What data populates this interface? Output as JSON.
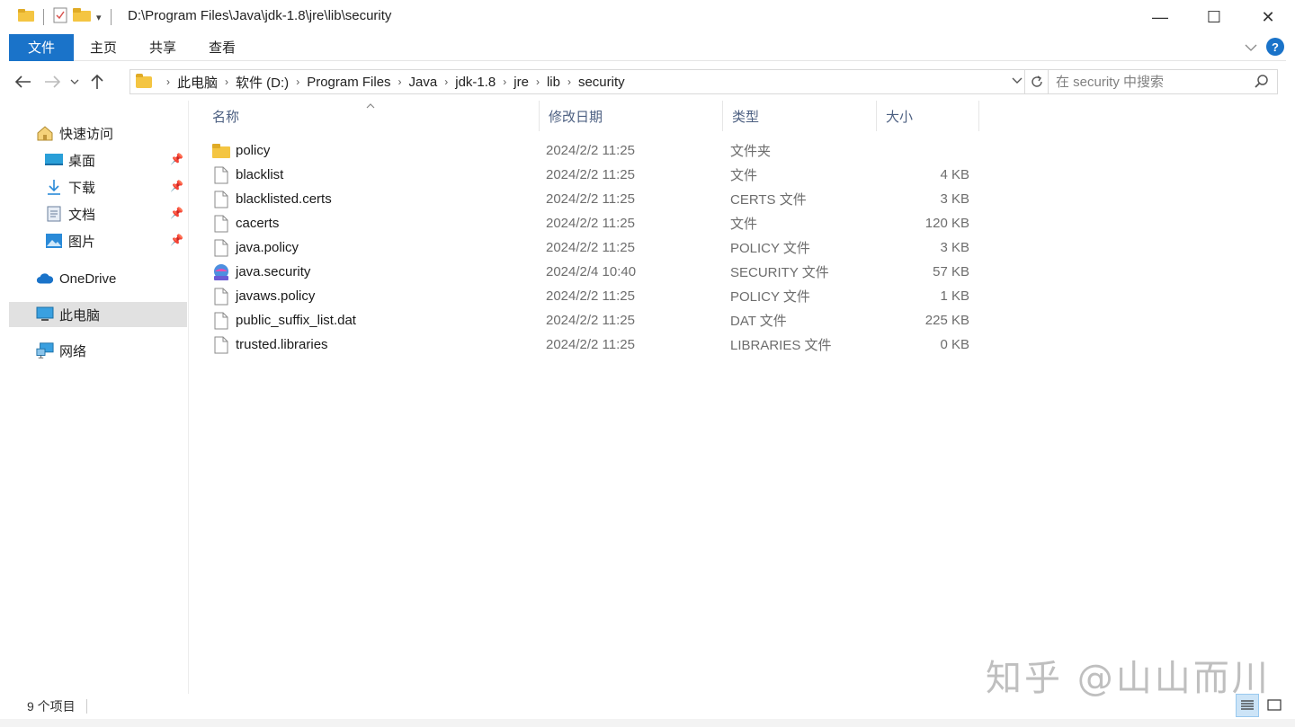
{
  "window": {
    "title": "D:\\Program Files\\Java\\jdk-1.8\\jre\\lib\\security",
    "minimize": "—",
    "maximize": "☐",
    "close": "✕"
  },
  "ribbon": {
    "tabs": [
      "文件",
      "主页",
      "共享",
      "查看"
    ],
    "help": "?"
  },
  "address": {
    "crumbs": [
      "此电脑",
      "软件 (D:)",
      "Program Files",
      "Java",
      "jdk-1.8",
      "jre",
      "lib",
      "security"
    ]
  },
  "search": {
    "placeholder": "在 security 中搜索"
  },
  "sidebar": {
    "items": [
      {
        "label": "快速访问",
        "icon": "star-icon"
      },
      {
        "label": "桌面",
        "icon": "desktop-icon",
        "pinned": true
      },
      {
        "label": "下载",
        "icon": "download-icon",
        "pinned": true
      },
      {
        "label": "文档",
        "icon": "document-icon",
        "pinned": true
      },
      {
        "label": "图片",
        "icon": "pictures-icon",
        "pinned": true
      },
      {
        "label": "OneDrive",
        "icon": "cloud-icon"
      },
      {
        "label": "此电脑",
        "icon": "computer-icon",
        "selected": true
      },
      {
        "label": "网络",
        "icon": "network-icon"
      }
    ]
  },
  "columns": [
    "名称",
    "修改日期",
    "类型",
    "大小"
  ],
  "files": [
    {
      "name": "policy",
      "date": "2024/2/2 11:25",
      "type": "文件夹",
      "size": "",
      "icon": "folder-icon"
    },
    {
      "name": "blacklist",
      "date": "2024/2/2 11:25",
      "type": "文件",
      "size": "4 KB",
      "icon": "file-icon"
    },
    {
      "name": "blacklisted.certs",
      "date": "2024/2/2 11:25",
      "type": "CERTS 文件",
      "size": "3 KB",
      "icon": "file-icon"
    },
    {
      "name": "cacerts",
      "date": "2024/2/2 11:25",
      "type": "文件",
      "size": "120 KB",
      "icon": "file-icon"
    },
    {
      "name": "java.policy",
      "date": "2024/2/2 11:25",
      "type": "POLICY 文件",
      "size": "3 KB",
      "icon": "file-icon"
    },
    {
      "name": "java.security",
      "date": "2024/2/4 10:40",
      "type": "SECURITY 文件",
      "size": "57 KB",
      "icon": "security-file-icon"
    },
    {
      "name": "javaws.policy",
      "date": "2024/2/2 11:25",
      "type": "POLICY 文件",
      "size": "1 KB",
      "icon": "file-icon"
    },
    {
      "name": "public_suffix_list.dat",
      "date": "2024/2/2 11:25",
      "type": "DAT 文件",
      "size": "225 KB",
      "icon": "file-icon"
    },
    {
      "name": "trusted.libraries",
      "date": "2024/2/2 11:25",
      "type": "LIBRARIES 文件",
      "size": "0 KB",
      "icon": "file-icon"
    }
  ],
  "status": {
    "count": "9 个项目"
  },
  "watermark": "知乎 @山山而川",
  "colors": {
    "accent": "#1a73c9",
    "folder": "#f4c542",
    "selected": "#e1e1e1",
    "header_text": "#4d6082"
  }
}
